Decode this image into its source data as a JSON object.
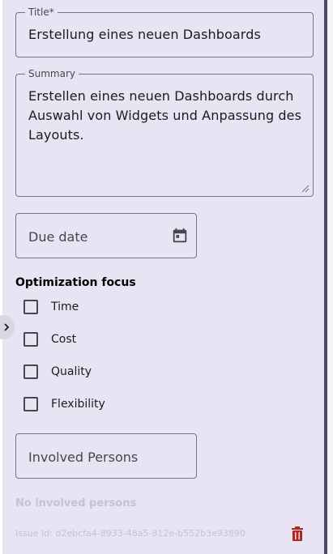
{
  "form": {
    "title": {
      "label": "Title*",
      "value": "Erstellung eines neuen Dashboards"
    },
    "summary": {
      "label": "Summary",
      "value_lines": [
        "Erstellen eines neuen Dashboards durch",
        "Auswahl von Widgets und Anpassung des",
        "Layouts."
      ]
    },
    "due_date": {
      "placeholder": "Due date",
      "icon": "calendar-icon"
    },
    "optimization": {
      "heading": "Optimization focus",
      "options": [
        {
          "label": "Time",
          "checked": false
        },
        {
          "label": "Cost",
          "checked": false
        },
        {
          "label": "Quality",
          "checked": false
        },
        {
          "label": "Flexibility",
          "checked": false
        }
      ]
    },
    "involved_persons": {
      "placeholder": "Involved Persons",
      "empty_text": "No involved persons"
    },
    "issue_id": "Issue Id: d2ebcfa4-8933-48a5-812e-b552b3e93890",
    "delete_icon": "trash-icon"
  },
  "colors": {
    "background": "#e8e4f3",
    "border": "#79747e",
    "muted_text": "#c6c2d6",
    "delete": "#b3261e"
  }
}
